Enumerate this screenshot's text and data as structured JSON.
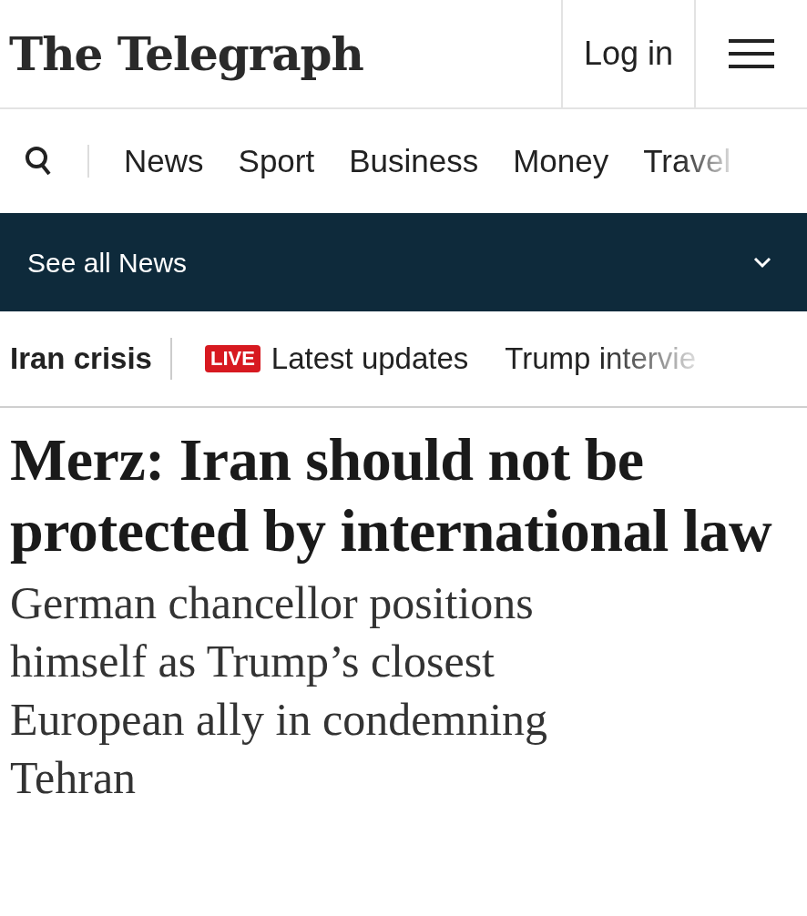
{
  "header": {
    "logo": "The Telegraph",
    "login": "Log in"
  },
  "nav": {
    "items": [
      "News",
      "Sport",
      "Business",
      "Money",
      "Travel"
    ]
  },
  "section_banner": {
    "label": "See all News",
    "expanded": false
  },
  "topics": {
    "title": "Iran crisis",
    "items": [
      {
        "badge": "LIVE",
        "label": "Latest updates"
      },
      {
        "label": "Trump intervie"
      }
    ]
  },
  "article": {
    "headline": "Merz: Iran should not be protected by international law",
    "standfirst": "German chancellor positions himself as Trump’s closest European ally in condemning Tehran"
  }
}
